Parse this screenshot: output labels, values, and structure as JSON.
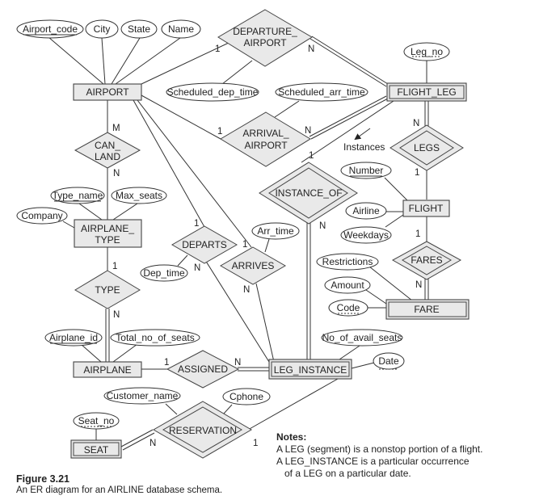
{
  "entities": {
    "airport": "AIRPORT",
    "flight_leg": "FLIGHT_LEG",
    "airplane_type": [
      "AIRPLANE_",
      "TYPE"
    ],
    "flight": "FLIGHT",
    "fare": "FARE",
    "airplane": "AIRPLANE",
    "leg_instance": "LEG_INSTANCE",
    "seat": "SEAT"
  },
  "relationships": {
    "departure_airport": [
      "DEPARTURE_",
      "AIRPORT"
    ],
    "arrival_airport": [
      "ARRIVAL_",
      "AIRPORT"
    ],
    "can_land": [
      "CAN_",
      "LAND"
    ],
    "legs": "LEGS",
    "instance_of": "INSTANCE_OF",
    "fares": "FARES",
    "departs": "DEPARTS",
    "arrives": "ARRIVES",
    "type": "TYPE",
    "assigned": "ASSIGNED",
    "reservation": "RESERVATION"
  },
  "attributes": {
    "airport_code": "Airport_code",
    "city": "City",
    "state": "State",
    "name": "Name",
    "leg_no": "Leg_no",
    "scheduled_dep_time": "Scheduled_dep_time",
    "scheduled_arr_time": "Scheduled_arr_time",
    "type_name": "Type_name",
    "max_seats": "Max_seats",
    "company": "Company",
    "number": "Number",
    "airline": "Airline",
    "weekdays": "Weekdays",
    "restrictions": "Restrictions",
    "amount": "Amount",
    "code": "Code",
    "arr_time": "Arr_time",
    "dep_time": "Dep_time",
    "airplane_id": "Airplane_id",
    "total_no_of_seats": "Total_no_of_seats",
    "no_of_avail_seats": "No_of_avail_seats",
    "date": "Date",
    "customer_name": "Customer_name",
    "cphone": "Cphone",
    "seat_no": "Seat_no"
  },
  "cardinalities": {
    "dep_airport_1": "1",
    "dep_airport_n": "N",
    "arr_airport_1": "1",
    "arr_airport_n": "N",
    "can_land_m": "M",
    "can_land_n": "N",
    "legs_n": "N",
    "legs_1": "1",
    "instance_of_1": "1",
    "instance_of_n": "N",
    "fares_1": "1",
    "fares_n": "N",
    "departs_1": "1",
    "departs_n": "N",
    "arrives_1": "1",
    "arrives_n": "N",
    "type_1": "1",
    "type_n": "N",
    "assigned_1": "1",
    "assigned_n": "N",
    "reservation_n": "N",
    "reservation_1": "1"
  },
  "annotations": {
    "instances": "Instances"
  },
  "notes": {
    "title": "Notes:",
    "line1": "A LEG (segment) is a nonstop portion of a flight.",
    "line2": "A LEG_INSTANCE is a particular occurrence",
    "line3": "of a LEG on a particular date."
  },
  "caption": {
    "figure": "Figure 3.21",
    "description": "An ER diagram for an AIRLINE database schema."
  }
}
